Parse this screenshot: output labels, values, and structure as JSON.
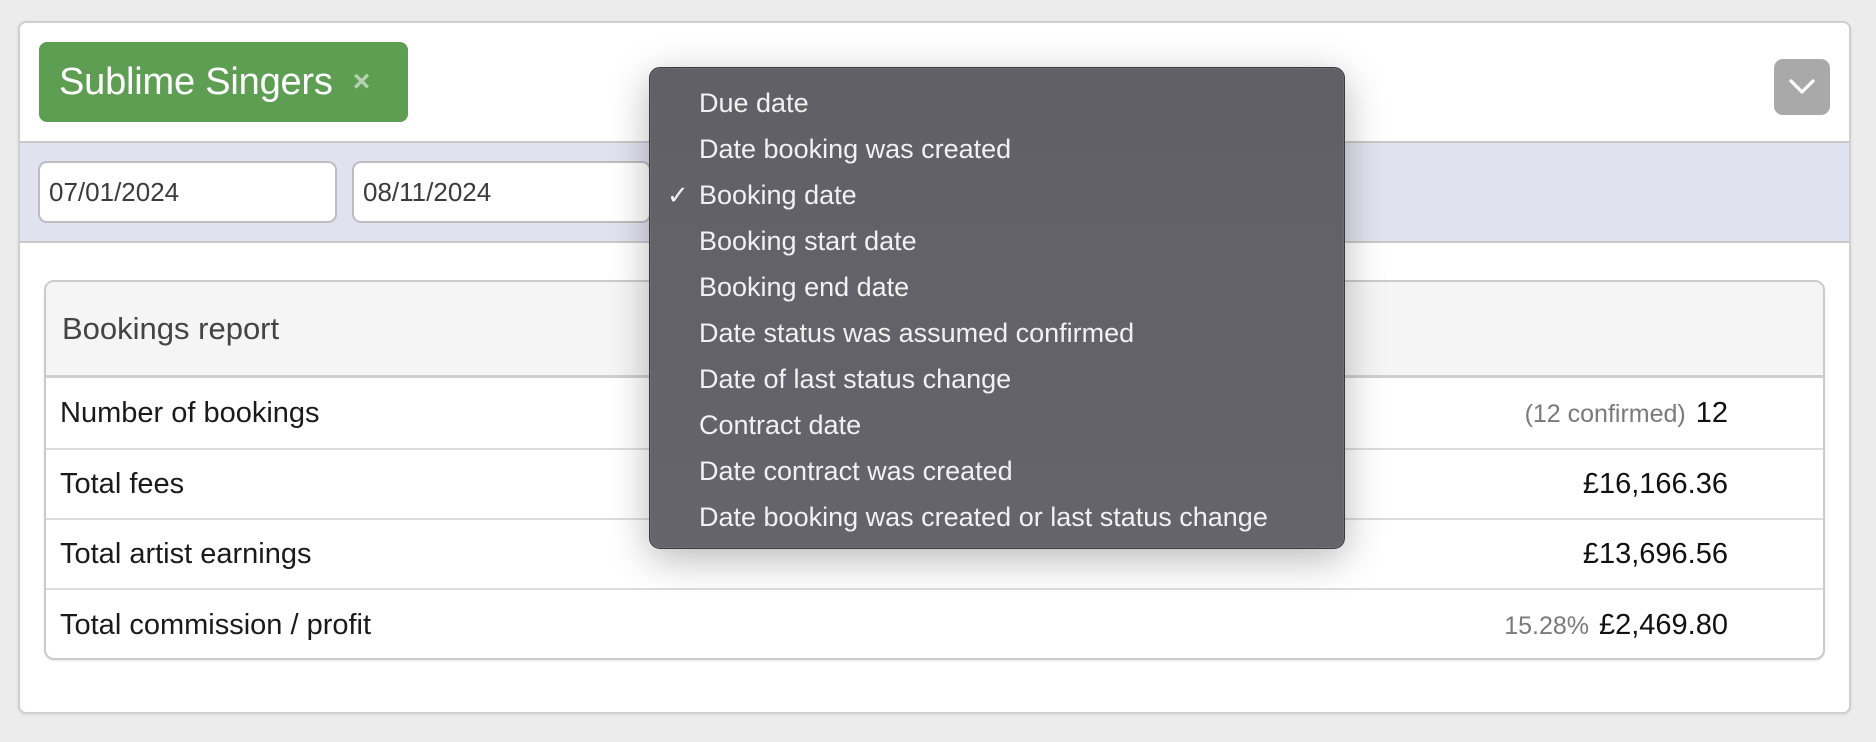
{
  "filter_tag": {
    "label": "Sublime Singers",
    "remove_symbol": "×"
  },
  "toggle_button": {
    "icon": "chevron-down-icon"
  },
  "date_range": {
    "from_value": "07/01/2024",
    "to_value": "08/11/2024"
  },
  "date_type_dropdown": {
    "selected": "Booking date",
    "check_symbol": "✓",
    "options": [
      "Due date",
      "Date booking was created",
      "Booking date",
      "Booking start date",
      "Booking end date",
      "Date status was assumed confirmed",
      "Date of last status change",
      "Contract date",
      "Date contract was created",
      "Date booking was created or last status change"
    ]
  },
  "report": {
    "title": "Bookings report",
    "rows": [
      {
        "label": "Number of bookings",
        "aux": "(12 confirmed)",
        "value": "12"
      },
      {
        "label": "Total fees",
        "aux": "",
        "value": "£16,166.36"
      },
      {
        "label": "Total artist earnings",
        "aux": "",
        "value": "£13,696.56"
      },
      {
        "label": "Total commission / profit",
        "aux": "15.28%",
        "value": "£2,469.80"
      }
    ]
  }
}
